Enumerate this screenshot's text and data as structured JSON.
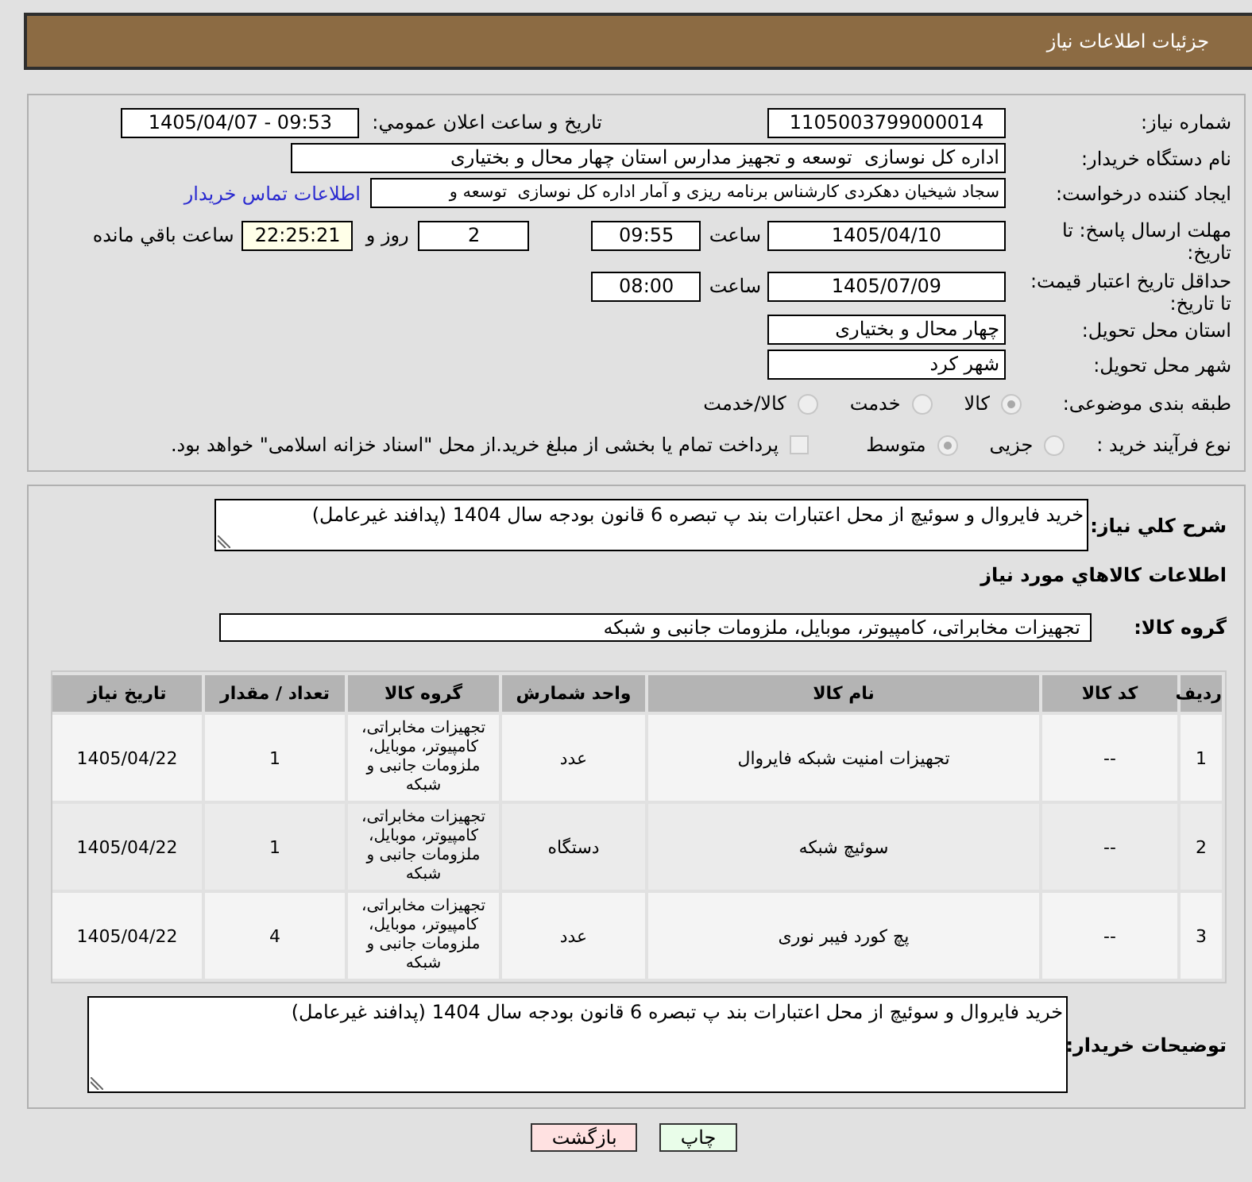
{
  "header": {
    "title": "جزئیات اطلاعات نیاز"
  },
  "need_number": {
    "label": "شماره نیاز:",
    "value": "1105003799000014"
  },
  "announcement": {
    "label": "تاریخ و ساعت اعلان عمومي:",
    "value": "1405/04/07 - 09:53"
  },
  "buyer_org": {
    "label": "نام دستگاه خریدار:",
    "value": "اداره کل نوسازی  توسعه و تجهیز مدارس استان چهار محال و بختیاری"
  },
  "requester": {
    "label": "ایجاد کننده درخواست:",
    "value": "سجاد شیخیان دهکردی کارشناس برنامه ریزی و آمار اداره کل نوسازی  توسعه و",
    "link": "اطلاعات تماس خریدار"
  },
  "reply_deadline": {
    "label": "مهلت ارسال پاسخ: تا تاریخ:",
    "date": "1405/04/10",
    "time_label": "ساعت",
    "time": "09:55",
    "days": "2",
    "days_label": "روز و",
    "remaining": "22:25:21",
    "remaining_label": "ساعت باقي مانده"
  },
  "price_validity": {
    "label": "حداقل تاریخ اعتبار قیمت: تا تاریخ:",
    "date": "1405/07/09",
    "time_label": "ساعت",
    "time": "08:00"
  },
  "delivery_province": {
    "label": "استان محل تحویل:",
    "value": "چهار محال و بختیاری"
  },
  "delivery_city": {
    "label": "شهر محل تحویل:",
    "value": "شهر کرد"
  },
  "subject_category": {
    "label": "طبقه بندی موضوعی:",
    "options": [
      {
        "label": "کالا",
        "selected": true,
        "disabled": true
      },
      {
        "label": "خدمت",
        "selected": false,
        "disabled": true
      },
      {
        "label": "کالا/خدمت",
        "selected": false,
        "disabled": true
      }
    ]
  },
  "purchase_process": {
    "label": "نوع فرآیند خرید :",
    "options": [
      {
        "label": "جزیی",
        "selected": false,
        "disabled": true
      },
      {
        "label": "متوسط",
        "selected": true,
        "disabled": true
      }
    ],
    "treasury_payment": {
      "label": "پرداخت تمام یا بخشی از مبلغ خرید.از محل \"اسناد خزانه اسلامی\" خواهد بود.",
      "checked": false,
      "disabled": true
    }
  },
  "need_summary": {
    "label": "شرح کلي نیاز:",
    "value": "خرید فایروال و سوئیچ از محل اعتبارات بند پ تبصره 6 قانون بودجه سال 1404 (پدافند غیرعامل)"
  },
  "goods_heading": "اطلاعات کالاهاي مورد نیاز",
  "goods_group": {
    "label": "گروه کالا:",
    "value": "تجهیزات مخابراتی، کامپیوتر، موبایل، ملزومات جانبی و شبکه"
  },
  "table": {
    "columns": [
      "ردیف",
      "کد کالا",
      "نام کالا",
      "واحد شمارش",
      "گروه کالا",
      "تعداد / مقدار",
      "تاریخ نیاز"
    ],
    "rows": [
      [
        "1",
        "--",
        "تجهیزات امنیت شبکه فایروال",
        "عدد",
        "تجهیزات مخابراتی، کامپیوتر، موبایل، ملزومات جانبی و شبکه",
        "1",
        "1405/04/22"
      ],
      [
        "2",
        "--",
        "سوئیچ شبکه",
        "دستگاه",
        "تجهیزات مخابراتی، کامپیوتر، موبایل، ملزومات جانبی و شبکه",
        "1",
        "1405/04/22"
      ],
      [
        "3",
        "--",
        "پچ کورد فیبر نوری",
        "عدد",
        "تجهیزات مخابراتی، کامپیوتر، موبایل، ملزومات جانبی و شبکه",
        "4",
        "1405/04/22"
      ]
    ]
  },
  "buyer_notes": {
    "label": "توضیحات خریدار:",
    "value": "خرید فایروال و سوئیچ از محل اعتبارات بند پ تبصره 6 قانون بودجه سال 1404 (پدافند غیرعامل)"
  },
  "buttons": [
    {
      "label": "چاپ",
      "kind": "print"
    },
    {
      "label": "بازگشت",
      "kind": "back"
    }
  ]
}
